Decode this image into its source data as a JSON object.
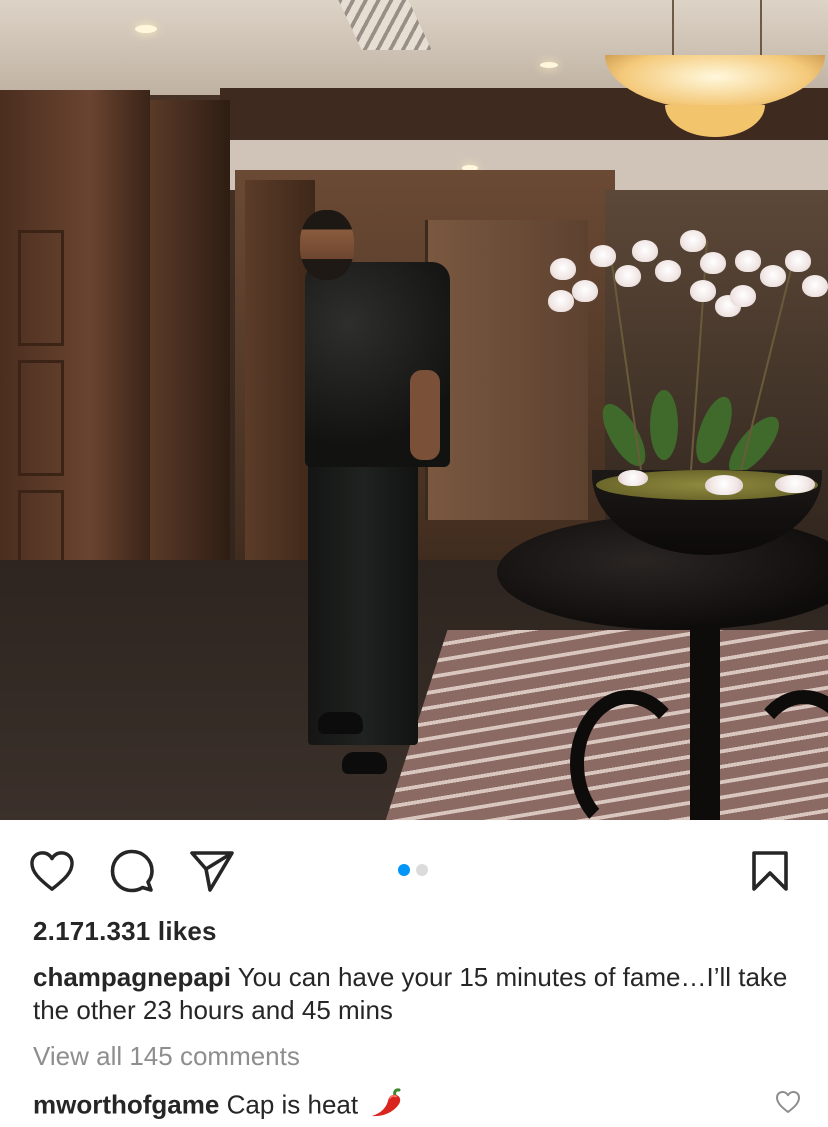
{
  "post": {
    "photo": {
      "alt_icon": "photo-image",
      "carousel": {
        "count": 2,
        "active_index": 0
      }
    },
    "actions": {
      "like_icon": "heart-icon",
      "comment_icon": "comment-icon",
      "share_icon": "send-icon",
      "save_icon": "bookmark-icon"
    },
    "likes": "2.171.331 likes",
    "caption": {
      "username": "champagnepapi",
      "text": "You can have your 15 minutes of fame…I’ll take the other 23 hours and 45 mins"
    },
    "view_all_comments": "View all 145 comments",
    "top_comment": {
      "username": "mworthofgame",
      "text": "Cap is heat",
      "emoji_icon": "chili-pepper-icon",
      "like_icon": "heart-outline-icon"
    }
  },
  "colors": {
    "text": "#262626",
    "muted": "#8e8e8e",
    "carousel_active": "#0095f6",
    "carousel_inactive": "#dbdbdb"
  }
}
